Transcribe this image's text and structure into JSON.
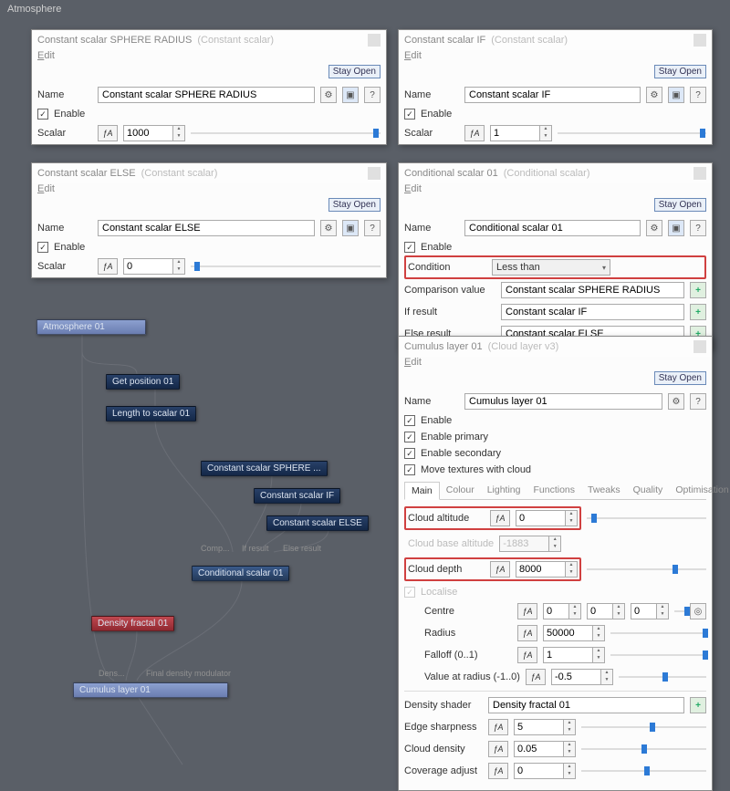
{
  "app_title": "Atmosphere",
  "buttons": {
    "stay_open": "Stay Open"
  },
  "edit_label": "Edit",
  "common": {
    "name_label": "Name",
    "enable_label": "Enable",
    "scalar_label": "Scalar",
    "help": "?",
    "fx": "ƒA"
  },
  "panel_sphere": {
    "title": "Constant scalar SPHERE RADIUS",
    "subtitle": "(Constant scalar)",
    "name": "Constant scalar SPHERE RADIUS",
    "enable": true,
    "scalar": "1000"
  },
  "panel_if": {
    "title": "Constant scalar IF",
    "subtitle": "(Constant scalar)",
    "name": "Constant scalar IF",
    "enable": true,
    "scalar": "1"
  },
  "panel_else": {
    "title": "Constant scalar ELSE",
    "subtitle": "(Constant scalar)",
    "name": "Constant scalar ELSE",
    "enable": true,
    "scalar": "0"
  },
  "panel_cond": {
    "title": "Conditional scalar 01",
    "subtitle": "(Conditional scalar)",
    "name": "Conditional scalar 01",
    "enable": true,
    "condition_label": "Condition",
    "condition_value": "Less than",
    "comparison_label": "Comparison value",
    "comparison_value": "Constant scalar SPHERE RADIUS",
    "if_label": "If result",
    "if_value": "Constant scalar IF",
    "else_label": "Else result",
    "else_value": "Constant scalar ELSE"
  },
  "panel_cumulus": {
    "title": "Cumulus layer 01",
    "subtitle": "(Cloud layer v3)",
    "name": "Cumulus layer 01",
    "enable": true,
    "enable_primary_label": "Enable primary",
    "enable_primary": true,
    "enable_secondary_label": "Enable secondary",
    "enable_secondary": true,
    "move_textures_label": "Move textures with cloud",
    "move_textures": true,
    "tabs": [
      "Main",
      "Colour",
      "Lighting",
      "Functions",
      "Tweaks",
      "Quality",
      "Optimisation"
    ],
    "active_tab": "Main",
    "cloud_altitude_label": "Cloud altitude",
    "cloud_altitude": "0",
    "cloud_base_label": "Cloud base altitude",
    "cloud_base": "-1883",
    "cloud_depth_label": "Cloud depth",
    "cloud_depth": "8000",
    "localise_label": "Localise",
    "centre_label": "Centre",
    "centre": [
      "0",
      "0",
      "0"
    ],
    "radius_label": "Radius",
    "radius": "50000",
    "falloff_label": "Falloff (0..1)",
    "falloff": "1",
    "value_at_radius_label": "Value at radius (-1..0)",
    "value_at_radius": "-0.5",
    "density_shader_label": "Density shader",
    "density_shader": "Density fractal 01",
    "edge_sharpness_label": "Edge sharpness",
    "edge_sharpness": "5",
    "cloud_density_label": "Cloud density",
    "cloud_density": "0.05",
    "coverage_adjust_label": "Coverage adjust",
    "coverage_adjust": "0"
  },
  "nodes": {
    "atmosphere": "Atmosphere 01",
    "get_position": "Get position 01",
    "length_to_scalar": "Length to scalar 01",
    "sphere": "Constant scalar SPHERE ...",
    "if": "Constant scalar IF",
    "else": "Constant scalar ELSE",
    "conditional": "Conditional scalar 01",
    "density_fractal": "Density fractal 01",
    "cumulus": "Cumulus layer 01",
    "label_comp": "Comp...",
    "label_if": "If result",
    "label_else": "Else result",
    "label_dens": "Dens...",
    "label_final": "Final density modulator"
  }
}
